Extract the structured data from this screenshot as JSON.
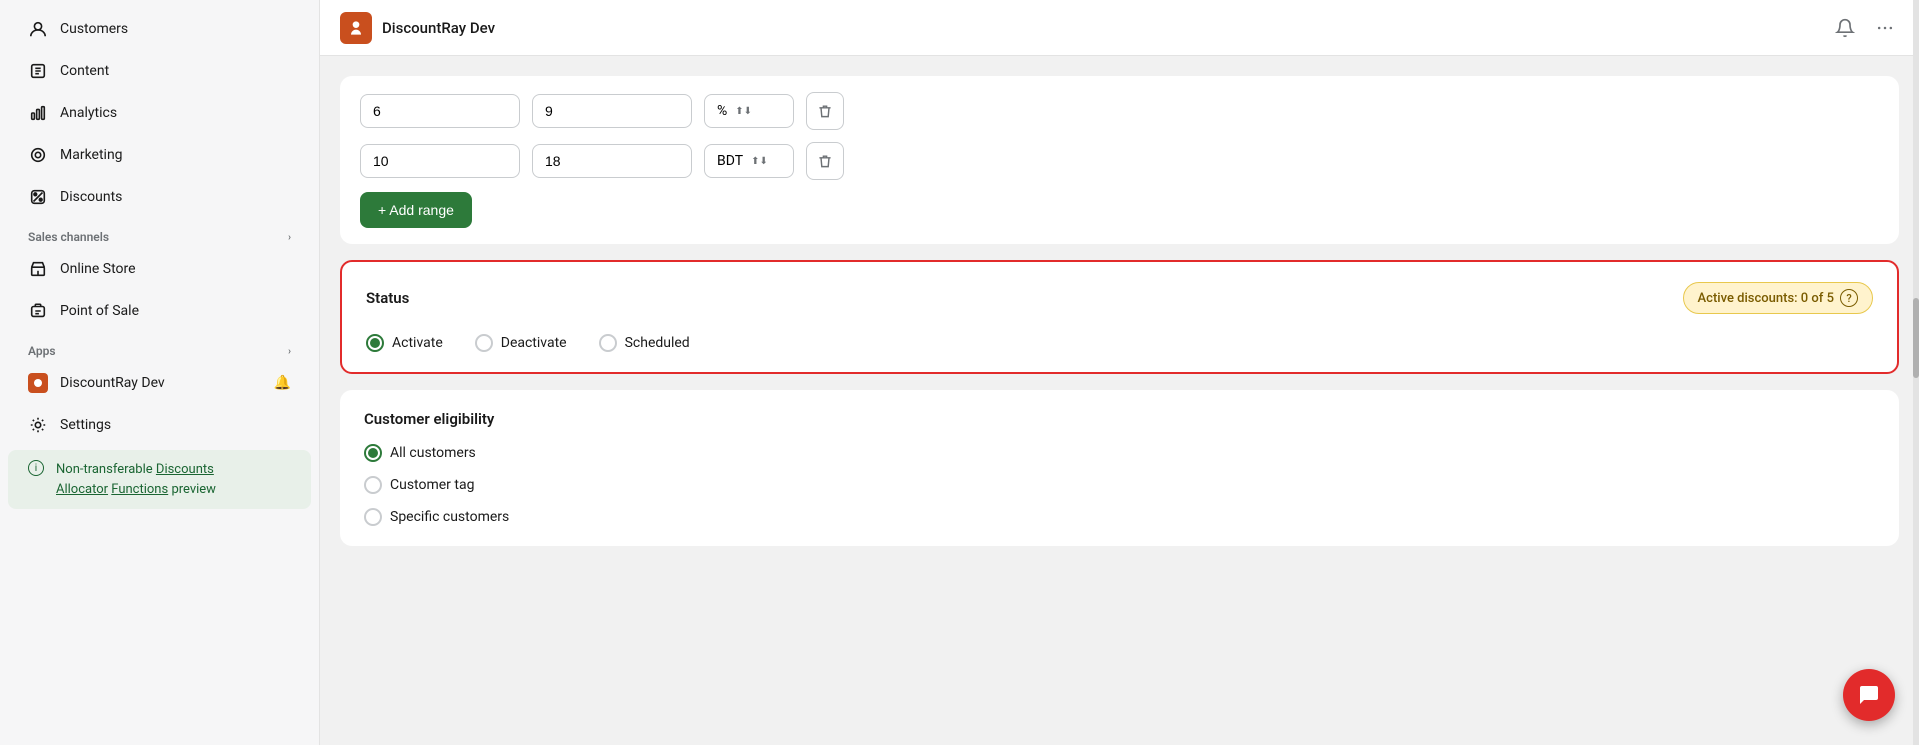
{
  "sidebar": {
    "items": [
      {
        "id": "customers",
        "label": "Customers",
        "icon": "person"
      },
      {
        "id": "content",
        "label": "Content",
        "icon": "document"
      },
      {
        "id": "analytics",
        "label": "Analytics",
        "icon": "bar-chart"
      },
      {
        "id": "marketing",
        "label": "Marketing",
        "icon": "target"
      },
      {
        "id": "discounts",
        "label": "Discounts",
        "icon": "gear"
      }
    ],
    "sales_channels_label": "Sales channels",
    "sales_channels": [
      {
        "id": "online-store",
        "label": "Online Store",
        "icon": "store"
      },
      {
        "id": "point-of-sale",
        "label": "Point of Sale",
        "icon": "card"
      }
    ],
    "apps_label": "Apps",
    "apps": [
      {
        "id": "discountray-dev",
        "label": "DiscountRay Dev",
        "icon": "app"
      }
    ],
    "settings_label": "Settings",
    "highlight": {
      "info_icon": "i",
      "line1": "Non-transferable",
      "link1": "Discounts Allocator",
      "link2": "Functions",
      "line2": "preview"
    }
  },
  "topbar": {
    "title": "DiscountRay Dev",
    "notification_icon": "bell",
    "more_icon": "ellipsis"
  },
  "range_card": {
    "rows": [
      {
        "qty": "6",
        "value": "9",
        "unit": "%",
        "unit_arrow": "⌃⌄"
      },
      {
        "qty": "10",
        "value": "18",
        "unit": "BDT",
        "unit_arrow": "⌃⌄"
      }
    ],
    "add_range_label": "+ Add range"
  },
  "status_card": {
    "title": "Status",
    "badge_label": "Active discounts: 0 of 5",
    "help_icon": "?",
    "options": [
      {
        "id": "activate",
        "label": "Activate",
        "selected": true
      },
      {
        "id": "deactivate",
        "label": "Deactivate",
        "selected": false
      },
      {
        "id": "scheduled",
        "label": "Scheduled",
        "selected": false
      }
    ]
  },
  "eligibility_card": {
    "title": "Customer eligibility",
    "options": [
      {
        "id": "all-customers",
        "label": "All customers",
        "selected": true
      },
      {
        "id": "customer-tag",
        "label": "Customer tag",
        "selected": false
      },
      {
        "id": "specific-customers",
        "label": "Specific customers",
        "selected": false
      }
    ]
  },
  "chat_button": {
    "icon": "💬"
  }
}
